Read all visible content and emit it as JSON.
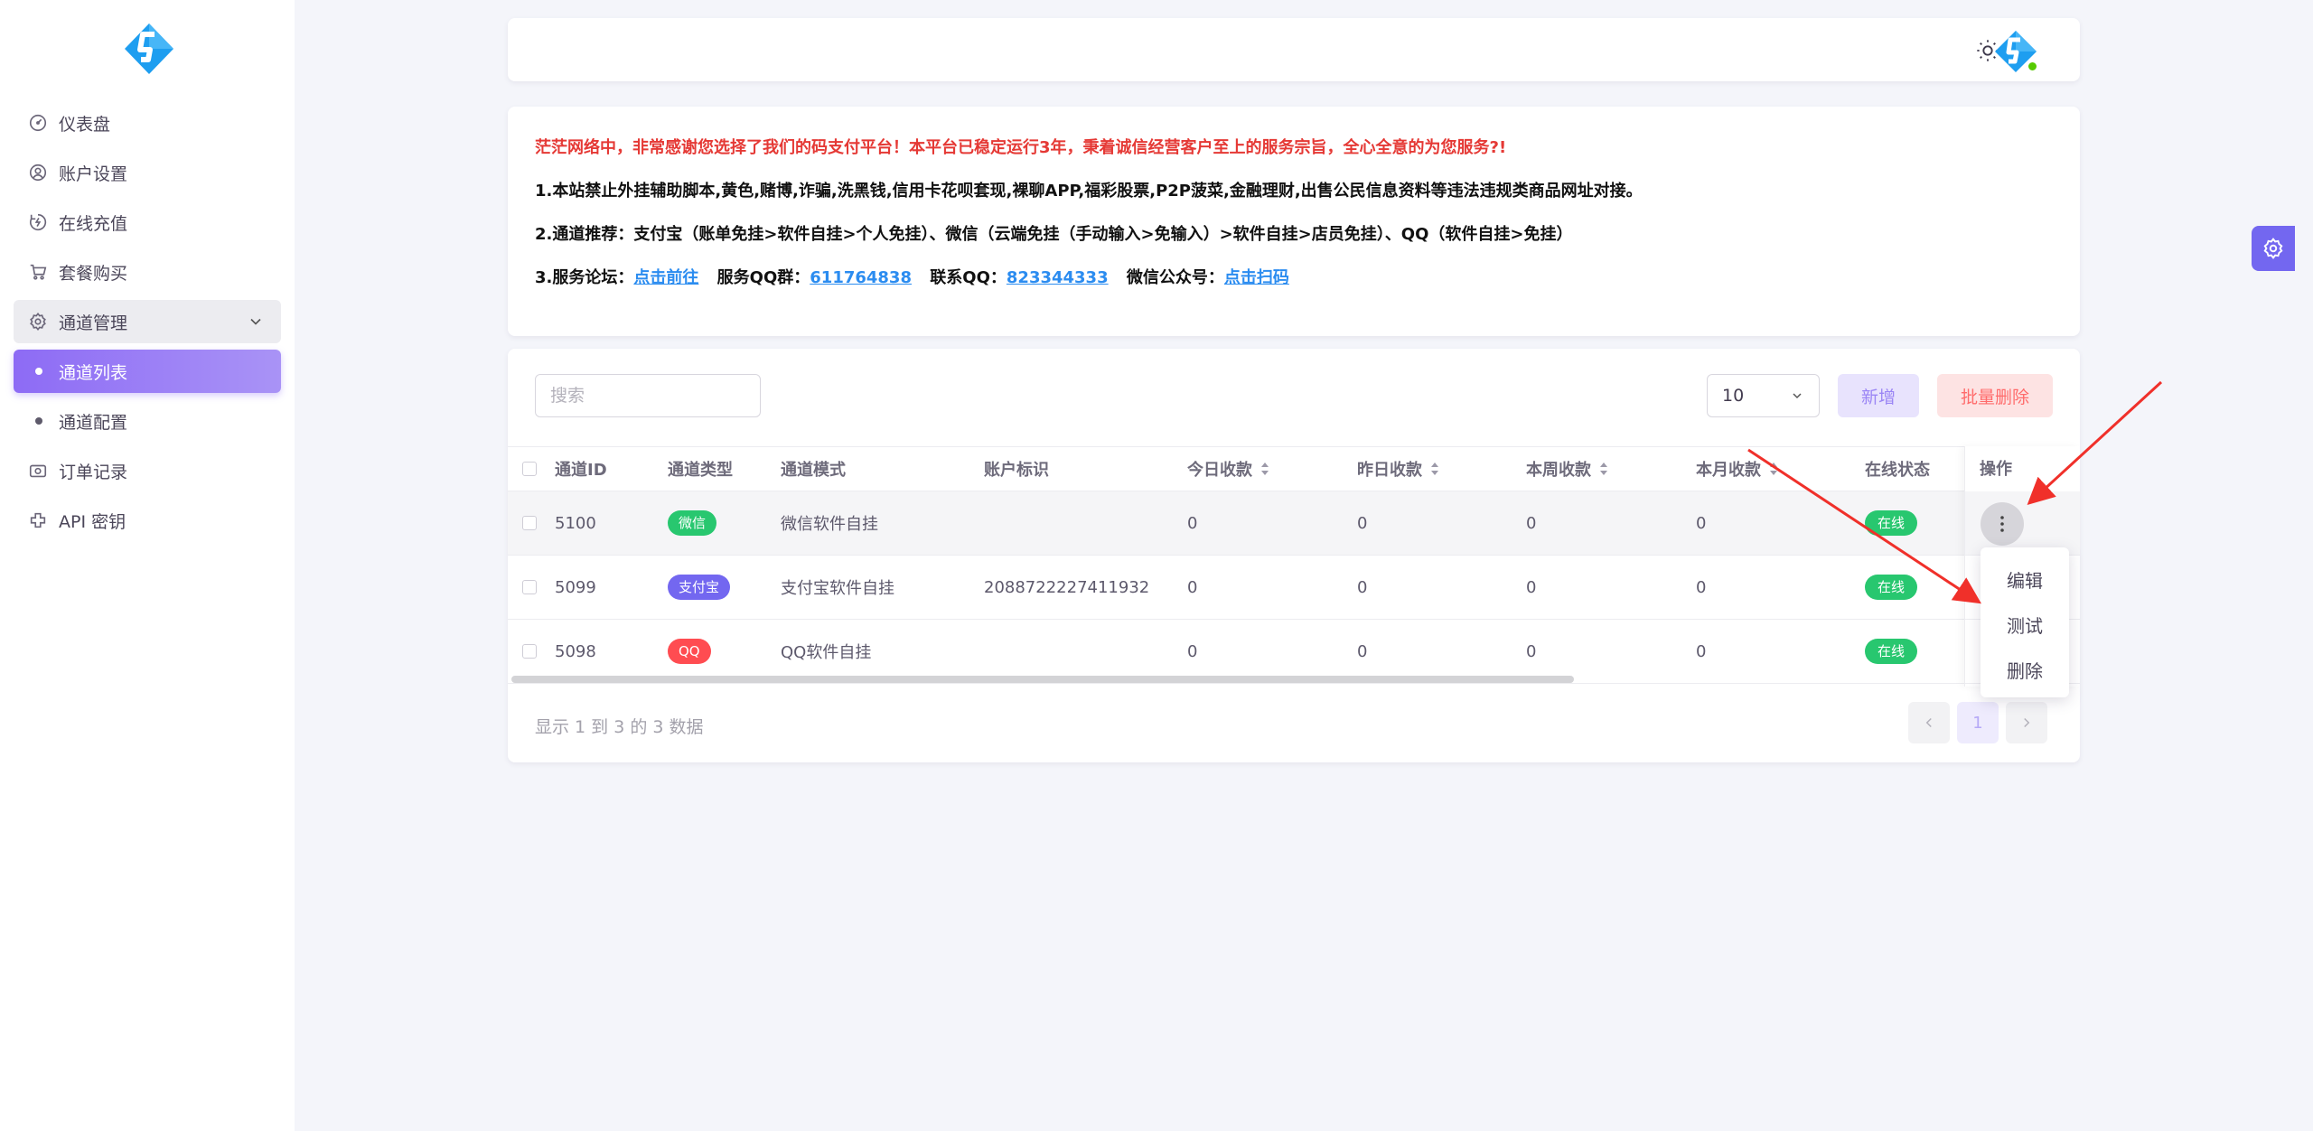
{
  "sidebar": {
    "items": [
      {
        "label": "仪表盘",
        "icon": "dashboard-icon"
      },
      {
        "label": "账户设置",
        "icon": "user-circle-icon"
      },
      {
        "label": "在线充值",
        "icon": "recharge-icon"
      },
      {
        "label": "套餐购买",
        "icon": "cart-icon"
      },
      {
        "label": "通道管理",
        "icon": "settings-icon"
      },
      {
        "label": "通道列表"
      },
      {
        "label": "通道配置"
      },
      {
        "label": "订单记录",
        "icon": "camera-icon"
      },
      {
        "label": "API 密钥",
        "icon": "api-icon"
      }
    ]
  },
  "notice": {
    "line1": "茫茫网络中，非常感谢您选择了我们的码支付平台！本平台已稳定运行3年，秉着诚信经营客户至上的服务宗旨，全心全意的为您服务?!",
    "line2": "1.本站禁止外挂辅助脚本,黄色,赌博,诈骗,洗黑钱,信用卡花呗套现,裸聊APP,福彩股票,P2P菠菜,金融理财,出售公民信息资料等违法违规类商品网址对接。",
    "line3": "2.通道推荐：支付宝（账单免挂>软件自挂>个人免挂）、微信（云端免挂（手动输入>免输入）>软件自挂>店员免挂）、QQ（软件自挂>免挂）",
    "line4": {
      "forum_label": "3.服务论坛：",
      "forum_link": "点击前往",
      "qq_group_label": "服务QQ群：",
      "qq_group": "611764838",
      "contact_label": "联系QQ：",
      "contact_qq": "823344333",
      "wechat_label": "微信公众号：",
      "wechat_link": "点击扫码"
    }
  },
  "toolbar": {
    "search_placeholder": "搜索",
    "page_size": "10",
    "add_label": "新增",
    "batch_delete_label": "批量删除"
  },
  "table": {
    "columns": [
      "通道ID",
      "通道类型",
      "通道模式",
      "账户标识",
      "今日收款",
      "昨日收款",
      "本周收款",
      "本月收款",
      "在线状态",
      "操作"
    ],
    "rows": [
      {
        "id": "5100",
        "type": "微信",
        "mode": "微信软件自挂",
        "account": "",
        "today": "0",
        "yesterday": "0",
        "week": "0",
        "month": "0",
        "status": "在线"
      },
      {
        "id": "5099",
        "type": "支付宝",
        "mode": "支付宝软件自挂",
        "account": "2088722227411932",
        "today": "0",
        "yesterday": "0",
        "week": "0",
        "month": "0",
        "status": "在线"
      },
      {
        "id": "5098",
        "type": "QQ",
        "mode": "QQ软件自挂",
        "account": "",
        "today": "0",
        "yesterday": "0",
        "week": "0",
        "month": "0",
        "status": "在线"
      }
    ]
  },
  "row_menu": {
    "items": [
      "编辑",
      "测试",
      "删除"
    ]
  },
  "footer": {
    "info": "显示 1 到 3 的 3 数据",
    "current_page": "1"
  },
  "colors": {
    "accent": "#7367f0",
    "wechat": "#28c76f",
    "alipay": "#7367f0",
    "qq": "#ff4c51",
    "online": "#28c76f",
    "notice_red": "#e53935",
    "link": "#2b8cf0",
    "arrow": "#f0302a"
  }
}
